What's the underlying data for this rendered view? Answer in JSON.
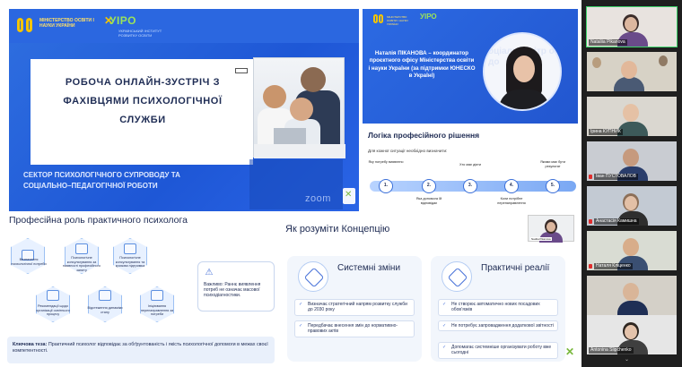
{
  "slide1": {
    "ministry": "МІНІСТЕРСТВО ОСВІТИ І НАУКИ УКРАЇНИ",
    "yipo": "УІРО",
    "yipo_sub": "УКРАЇНСЬКИЙ ІНСТИТУТ РОЗВИТКУ ОСВІТИ",
    "title": "РОБОЧА ОНЛАЙН-ЗУСТРІЧ З ФАХІВЦЯМИ ПСИХОЛОГІЧНОЇ СЛУЖБИ",
    "subtitle": "СЕКТОР ПСИХОЛОГІЧНОГО СУПРОВОДУ ТА СОЦІАЛЬНО–ПЕДАГОГІЧНОЇ РОБОТИ",
    "zoom": "zoom"
  },
  "slide2": {
    "name": "Наталія ПІКАНОВА – координатор проєктного офісу Міністерства освіти і науки України (за підтримки ЮНЕСКО в Україні)",
    "bg_text": "оціальні дітр ов до"
  },
  "slide3": {
    "title": "Логіка професійного рішення",
    "subtitle": "Для кожної ситуації необхідно визначити:",
    "steps": [
      {
        "num": "1.",
        "top": "Яку потребу виявлено",
        "bottom": ""
      },
      {
        "num": "2.",
        "top": "",
        "bottom": "Яка допомога їй відповідає"
      },
      {
        "num": "3.",
        "top": "Хто має діяти",
        "bottom": ""
      },
      {
        "num": "4.",
        "top": "",
        "bottom": "Коли потрібне перенаправлення"
      },
      {
        "num": "5.",
        "top": "Якими має бути результат",
        "bottom": ""
      }
    ]
  },
  "slide4": {
    "title": "Професійна роль практичного психолога",
    "hexes": [
      "Визначення психологічної потреби",
      "Психологічне оцінювання психологічного стану",
      "Психологічне консультування та кризова підтримка",
      "Рекомендації щодо організації освітнього процесу",
      "Відстеження динаміки стану",
      "Ініціювання перенаправлення за потреби",
      "Психологічне консультування за наявності професійного запиту"
    ],
    "warning": "Важливо: Раннє виявлення потреб не означає масової психодіагностики.",
    "thesis_label": "Ключова теза:",
    "thesis": "Практичний психолог відповідає за обґрунтованість і якість психологічної допомоги в межах своєї компетентності."
  },
  "slide5": {
    "title": "Як розуміти Концепцію",
    "cam_name": "Nadiia Pikanova",
    "left": {
      "title": "Системні зміни",
      "items": [
        "Визначає стратегічний напрям розвитку служби до 2030 року",
        "Передбачає внесення змін до нормативно-правових актів"
      ]
    },
    "right": {
      "title": "Практичні реалії",
      "items": [
        "Не створює автоматично нових посадових обов’язків",
        "Не потребує запровадження додаткової звітності",
        "Допомагає системніше організувати роботу вже сьогодні"
      ]
    }
  },
  "participants": [
    {
      "name": "Nataliia Pikanova",
      "active": true,
      "mic_off": false
    },
    {
      "name": "",
      "active": false,
      "mic_off": false
    },
    {
      "name": "Ірина КУПНИК",
      "active": false,
      "mic_off": false
    },
    {
      "name": "Іван ПУСТОВАЛОВ",
      "active": false,
      "mic_off": true
    },
    {
      "name": "Анастасія Камишна",
      "active": false,
      "mic_off": true
    },
    {
      "name": "Наталя Кліценко",
      "active": false,
      "mic_off": true
    },
    {
      "name": "",
      "active": false,
      "mic_off": false
    },
    {
      "name": "Antonina Slipchenko",
      "active": false,
      "mic_off": false
    }
  ],
  "colors": {
    "slide_blue": "#2b67e0",
    "navy_text": "#1d2a52",
    "accent_green": "#79b83d",
    "accent_yellow": "#f4c400",
    "active_speaker": "#3cd36a"
  }
}
